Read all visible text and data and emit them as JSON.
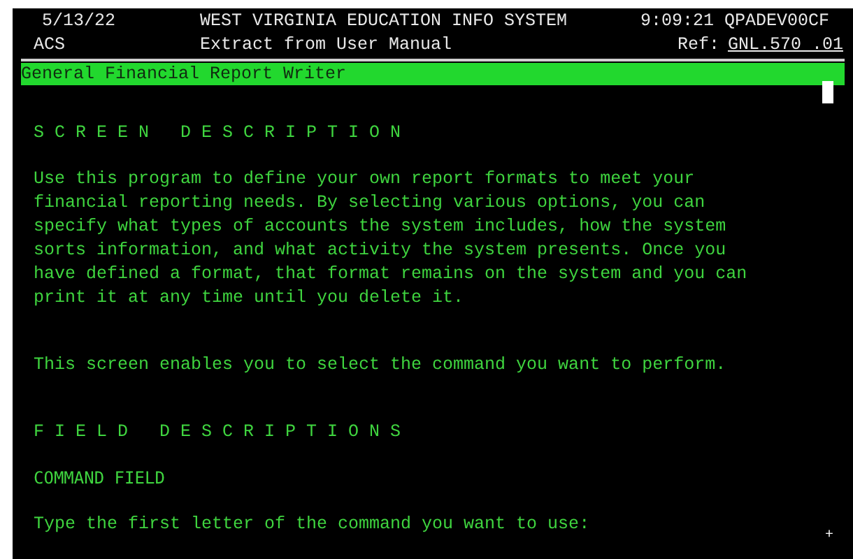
{
  "header": {
    "date": "5/13/22",
    "system_title": "WEST VIRGINIA EDUCATION INFO SYSTEM",
    "time_device": "9:09:21 QPADEV00CF",
    "app": "ACS",
    "subtitle": "Extract from User Manual",
    "ref_label": "Ref:",
    "ref_value": "GNL.570 .01"
  },
  "title_bar": "General Financial Report Writer",
  "sections": [
    {
      "kind": "heading",
      "text": "S C R E E N   D E S C R I P T I O N"
    },
    {
      "kind": "paragraph",
      "lines": [
        "Use this program to define your own report formats to meet your",
        "financial reporting needs. By selecting various options, you can",
        "specify what types of accounts the system includes, how the system",
        "sorts information, and what activity the system presents. Once you",
        "have defined a format, that format remains on the system and you can",
        "print it at any time until you delete it."
      ]
    },
    {
      "kind": "paragraph",
      "lines": [
        "This screen enables you to select the command you want to perform."
      ]
    },
    {
      "kind": "heading",
      "text": "F I E L D   D E S C R I P T I O N S"
    },
    {
      "kind": "label",
      "text": "COMMAND FIELD"
    },
    {
      "kind": "paragraph",
      "lines": [
        "Type the first letter of the command you want to use:"
      ]
    }
  ],
  "more_indicator": "+"
}
